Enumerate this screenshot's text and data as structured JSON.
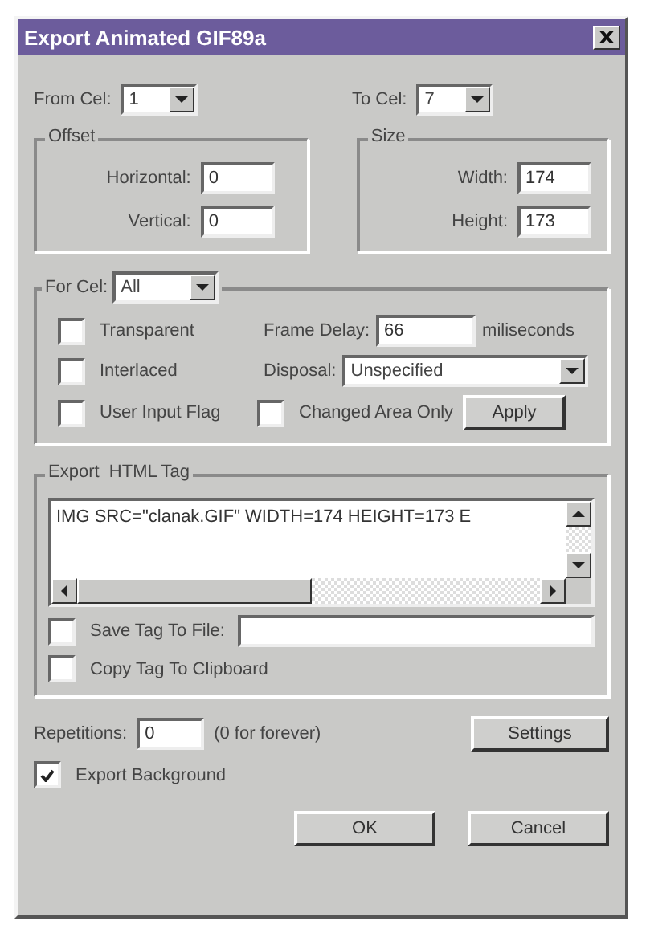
{
  "window": {
    "title": "Export Animated GIF89a"
  },
  "from_cel": {
    "label": "From Cel:",
    "value": "1"
  },
  "to_cel": {
    "label": "To Cel:",
    "value": "7"
  },
  "offset": {
    "title": "Offset",
    "fields": [
      {
        "label": "Horizontal:",
        "value": "0"
      },
      {
        "label": "Vertical:",
        "value": "0"
      }
    ]
  },
  "size": {
    "title": "Size",
    "fields": [
      {
        "label": "Width:",
        "value": "174"
      },
      {
        "label": "Height:",
        "value": "173"
      }
    ]
  },
  "for_cel": {
    "label": "For Cel:",
    "value": "All",
    "transparent": {
      "label": "Transparent",
      "checked": false
    },
    "interlaced": {
      "label": "Interlaced",
      "checked": false
    },
    "user_input_flag": {
      "label": "User Input Flag",
      "checked": false
    },
    "changed_area_only": {
      "label": "Changed Area Only",
      "checked": false
    },
    "frame_delay": {
      "label": "Frame Delay:",
      "value": "66",
      "unit": "miliseconds"
    },
    "disposal": {
      "label": "Disposal:",
      "value": "Unspecified"
    },
    "apply": "Apply"
  },
  "export_html_tag": {
    "title": "Export  HTML Tag",
    "text": "IMG SRC=\"clanak.GIF\" WIDTH=174 HEIGHT=173 E",
    "save_tag_to_file": {
      "label": "Save Tag To File:",
      "checked": false
    },
    "copy_tag_to_clipboard": {
      "label": "Copy Tag To Clipboard",
      "checked": false
    }
  },
  "repetitions": {
    "label": "Repetitions:",
    "value": "0",
    "hint": "(0 for forever)"
  },
  "settings": "Settings",
  "export_background": {
    "label": "Export Background",
    "checked": true
  },
  "buttons": [
    "OK",
    "Cancel"
  ]
}
